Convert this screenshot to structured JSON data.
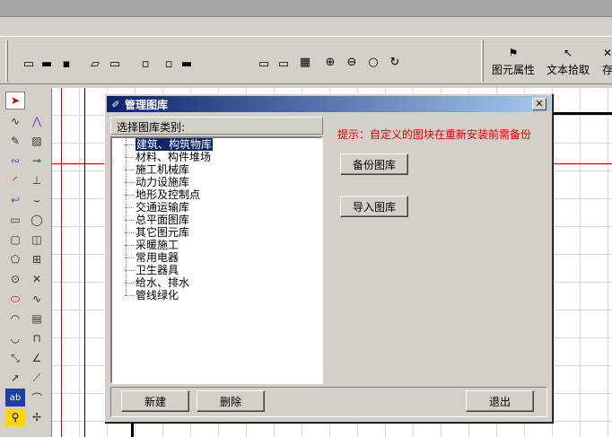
{
  "toolbar": {
    "element_props_label": "图元属性",
    "text_pick_label": "文本拾取",
    "overflow_label": "存"
  },
  "dialog": {
    "title": "管理图库",
    "close_glyph": "✕",
    "list_header": "选择图库类别:",
    "categories": [
      "建筑、构筑物库",
      "材料、构件堆场",
      "施工机械库",
      "动力设施库",
      "地形及控制点",
      "交通运输库",
      "总平面图库",
      "其它图元库",
      "采暖施工",
      "常用电器",
      "卫生器具",
      "给水、排水",
      "管线绿化"
    ],
    "selected_category": "建筑、构筑物库",
    "hint": "提示：自定义的图块在重新安装前需备份",
    "backup_button": "备份图库",
    "import_button": "导入图库",
    "new_button": "新建",
    "delete_button": "删除",
    "exit_button": "退出"
  },
  "colors": {
    "title_gradient_start": "#0a246a",
    "title_gradient_end": "#a6caf0",
    "hint_red": "#e00000",
    "face": "#d4d0c8"
  }
}
